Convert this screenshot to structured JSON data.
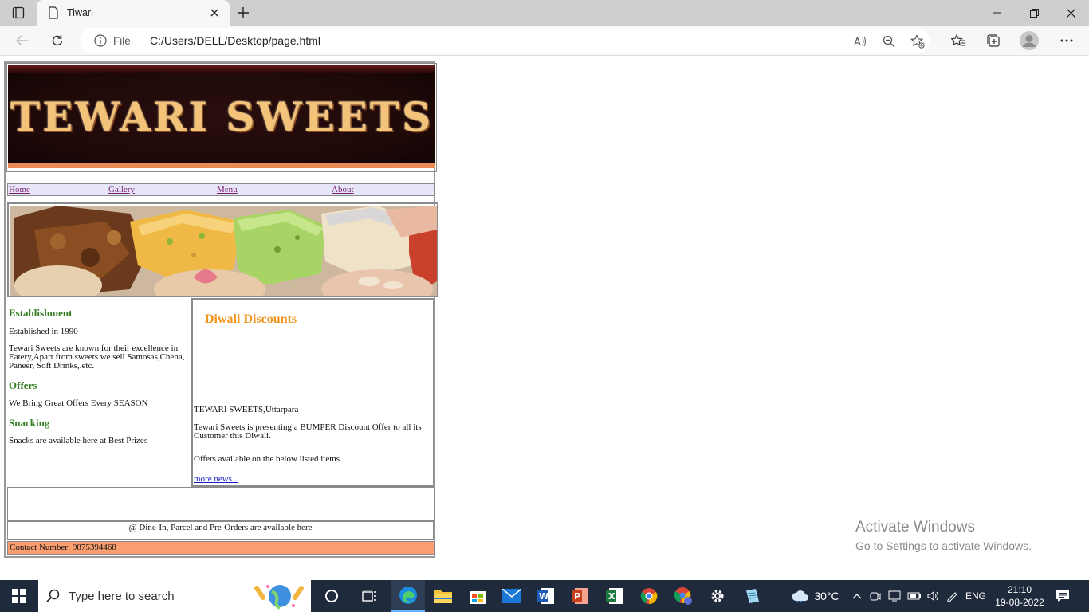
{
  "browser": {
    "tab_title": "Tiwari",
    "address_prefix": "File",
    "url": "C:/Users/DELL/Desktop/page.html"
  },
  "page": {
    "banner_text": "TEWARI SWEETS",
    "nav": [
      "Home",
      "Gallery",
      "Menu",
      "About"
    ],
    "left": {
      "establishment_heading": "Establishment",
      "established": "Established in 1990",
      "about": "Tewari Sweets are known for their excellence in Eatery,Apart from sweets we sell Samosas,Chena, Paneer, Soft Drinks,.etc.",
      "offers_heading": "Offers",
      "offers_text": "We Bring Great Offers Every SEASON",
      "snacking_heading": "Snacking",
      "snacking_text": "Snacks are available here at Best Prizes"
    },
    "right": {
      "heading": "Diwali Discounts",
      "location": "TEWARI SWEETS,Uttarpara",
      "offer_text": "Tewari Sweets is presenting a BUMPER Discount Offer to all its Customer this Diwali.",
      "items_text": "Offers available on the below listed items",
      "more_link": "more news .."
    },
    "footer_caption": "@ Dine-In, Parcel and Pre-Orders are available here",
    "contact": "Contact Number: 9875394468"
  },
  "watermark": {
    "line1": "Activate Windows",
    "line2": "Go to Settings to activate Windows."
  },
  "taskbar": {
    "search_placeholder": "Type here to search",
    "temperature": "30°C",
    "language": "ENG",
    "time": "21:10",
    "date": "19-08-2022"
  },
  "colors": {
    "nav_link": "#7a1c6e",
    "heading_green": "#2f7d1c",
    "diwali_orange": "#f0941c",
    "contact_bg": "#fb9f70"
  }
}
